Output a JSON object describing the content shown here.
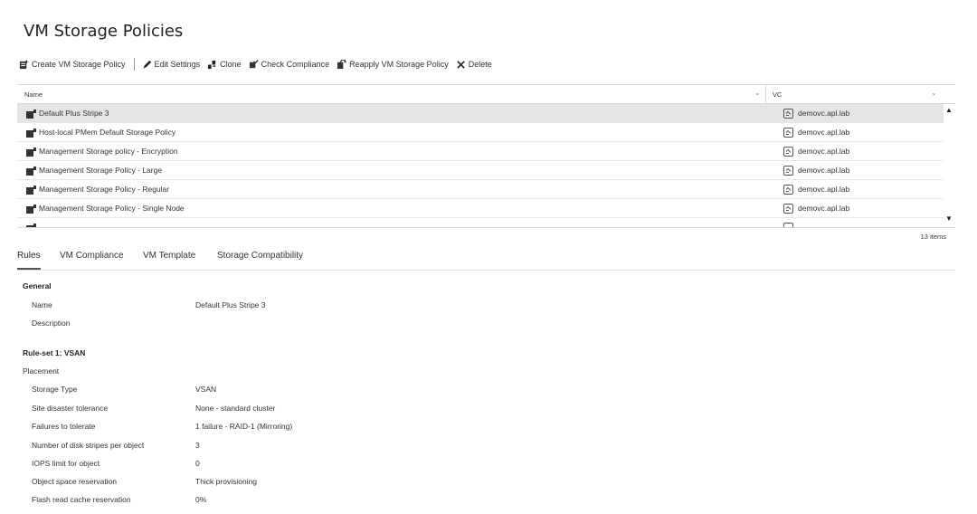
{
  "page": {
    "title": "VM Storage Policies"
  },
  "toolbar": {
    "create": "Create VM Storage Policy",
    "edit": "Edit Settings",
    "clone": "Clone",
    "check": "Check Compliance",
    "reapply": "Reapply VM Storage Policy",
    "delete": "Delete"
  },
  "grid": {
    "col_name": "Name",
    "col_vc": "VC",
    "rows": [
      {
        "name": "Default Plus Stripe 3",
        "vc": "demovc.apl.lab",
        "selected": true
      },
      {
        "name": "Host-local PMem Default Storage Policy",
        "vc": "demovc.apl.lab"
      },
      {
        "name": "Management Storage policy - Encryption",
        "vc": "demovc.apl.lab"
      },
      {
        "name": "Management Storage Policy - Large",
        "vc": "demovc.apl.lab"
      },
      {
        "name": "Management Storage Policy - Regular",
        "vc": "demovc.apl.lab"
      },
      {
        "name": "Management Storage Policy - Single Node",
        "vc": "demovc.apl.lab"
      }
    ],
    "items_count": "13 items"
  },
  "tabs": [
    "Rules",
    "VM Compliance",
    "VM Template",
    "Storage Compatibility"
  ],
  "details": {
    "general_heading": "General",
    "name_label": "Name",
    "name_value": "Default Plus Stripe 3",
    "description_label": "Description",
    "ruleset_heading": "Rule-set 1: VSAN",
    "placement_heading": "Placement",
    "properties": [
      {
        "label": "Storage Type",
        "value": "VSAN"
      },
      {
        "label": "Site disaster tolerance",
        "value": "None - standard cluster"
      },
      {
        "label": "Failures to tolerate",
        "value": "1 failure - RAID-1 (Mirroring)"
      },
      {
        "label": "Number of disk stripes per object",
        "value": "3"
      },
      {
        "label": "IOPS limit for object",
        "value": "0"
      },
      {
        "label": "Object space reservation",
        "value": "Thick provisioning"
      },
      {
        "label": "Flash read cache reservation",
        "value": "0%"
      }
    ]
  }
}
